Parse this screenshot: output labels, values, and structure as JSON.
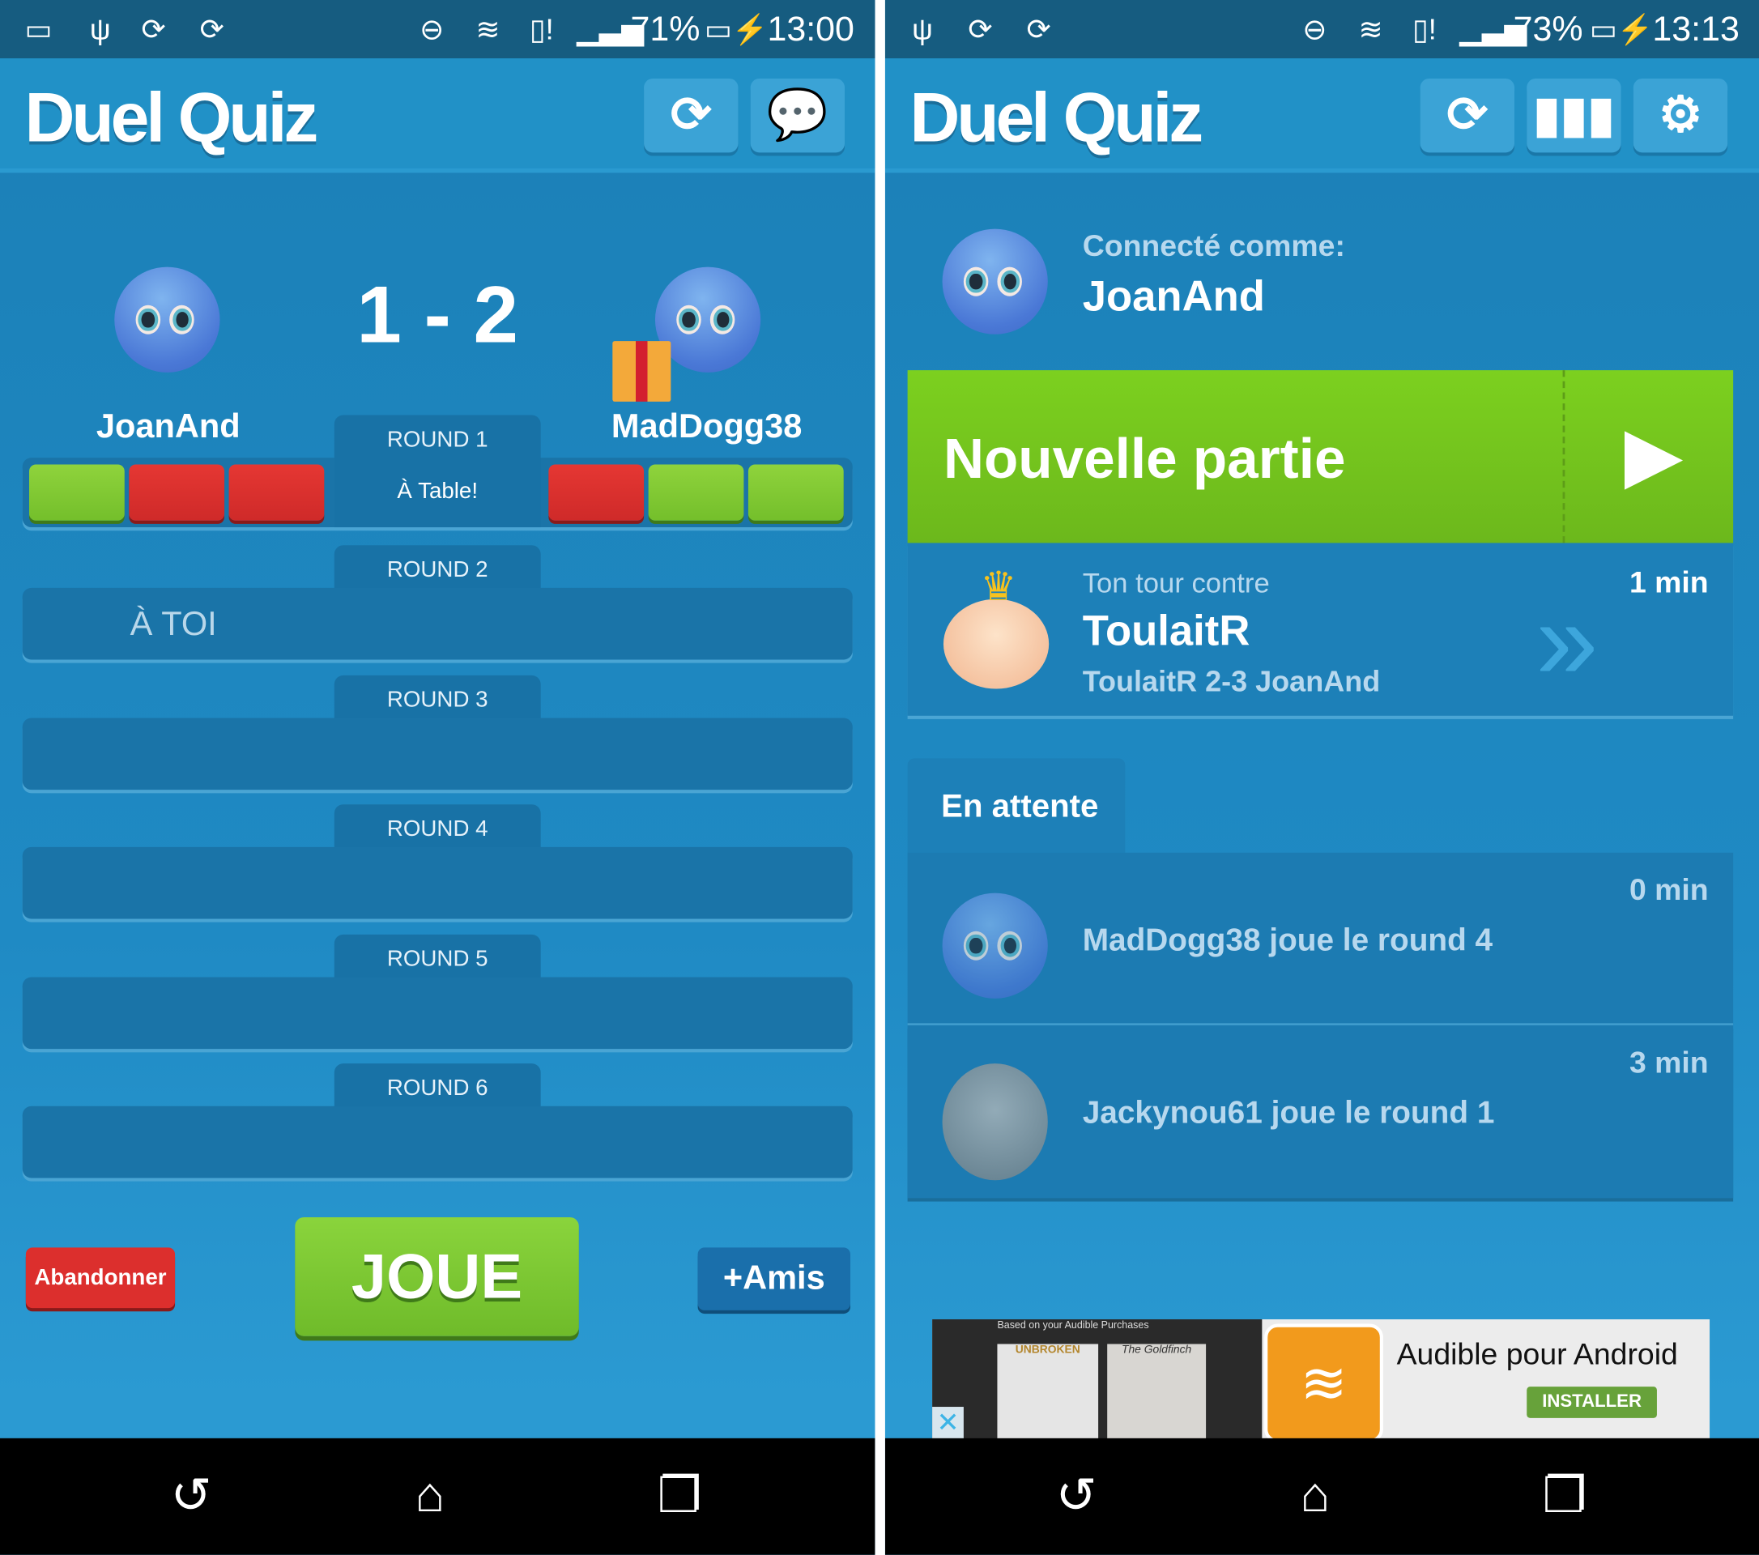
{
  "left": {
    "status": {
      "battery": "71%",
      "time": "13:00"
    },
    "app_title": "Duel Quiz",
    "header_buttons": [
      {
        "icon": "refresh-icon"
      },
      {
        "icon": "chat-icon"
      }
    ],
    "score": "1 - 2",
    "player1": "JoanAnd",
    "player2": "MadDogg38",
    "player1_answers": [
      "correct",
      "wrong",
      "wrong"
    ],
    "player2_answers": [
      "wrong",
      "correct",
      "correct"
    ],
    "rounds": [
      {
        "label": "ROUND 1",
        "category": "À Table!"
      },
      {
        "label": "ROUND 2",
        "status": "À TOI"
      },
      {
        "label": "ROUND 3"
      },
      {
        "label": "ROUND 4"
      },
      {
        "label": "ROUND 5"
      },
      {
        "label": "ROUND 6"
      }
    ],
    "abandon_label": "Abandonner",
    "play_label": "JOUE",
    "friends_label": "+Amis"
  },
  "right": {
    "status": {
      "battery": "73%",
      "time": "13:13"
    },
    "app_title": "Duel Quiz",
    "header_buttons": [
      {
        "icon": "refresh-icon"
      },
      {
        "icon": "stats-icon"
      },
      {
        "icon": "settings-icon"
      }
    ],
    "connected_label": "Connecté comme:",
    "username": "JoanAnd",
    "new_game_label": "Nouvelle partie",
    "turn": {
      "label": "Ton tour contre",
      "opponent": "ToulaitR",
      "score": "ToulaitR 2-3 JoanAnd",
      "time": "1 min"
    },
    "waiting_label": "En attente",
    "waiting": [
      {
        "text": "MadDogg38 joue le round 4",
        "time": "0 min"
      },
      {
        "text": "Jackynou61 joue le round 1",
        "time": "3 min"
      }
    ],
    "ad": {
      "caption": "Based on your Audible Purchases",
      "book1": "UNBROKEN",
      "book2": "The Goldfinch",
      "title": "Audible pour Android",
      "button": "INSTALLER"
    }
  },
  "colors": {
    "green": "#7ac52e",
    "red": "#dc3130",
    "header": "#2191c7",
    "status": "#165c80",
    "install": "#67a23a",
    "audible": "#f29a1c"
  }
}
